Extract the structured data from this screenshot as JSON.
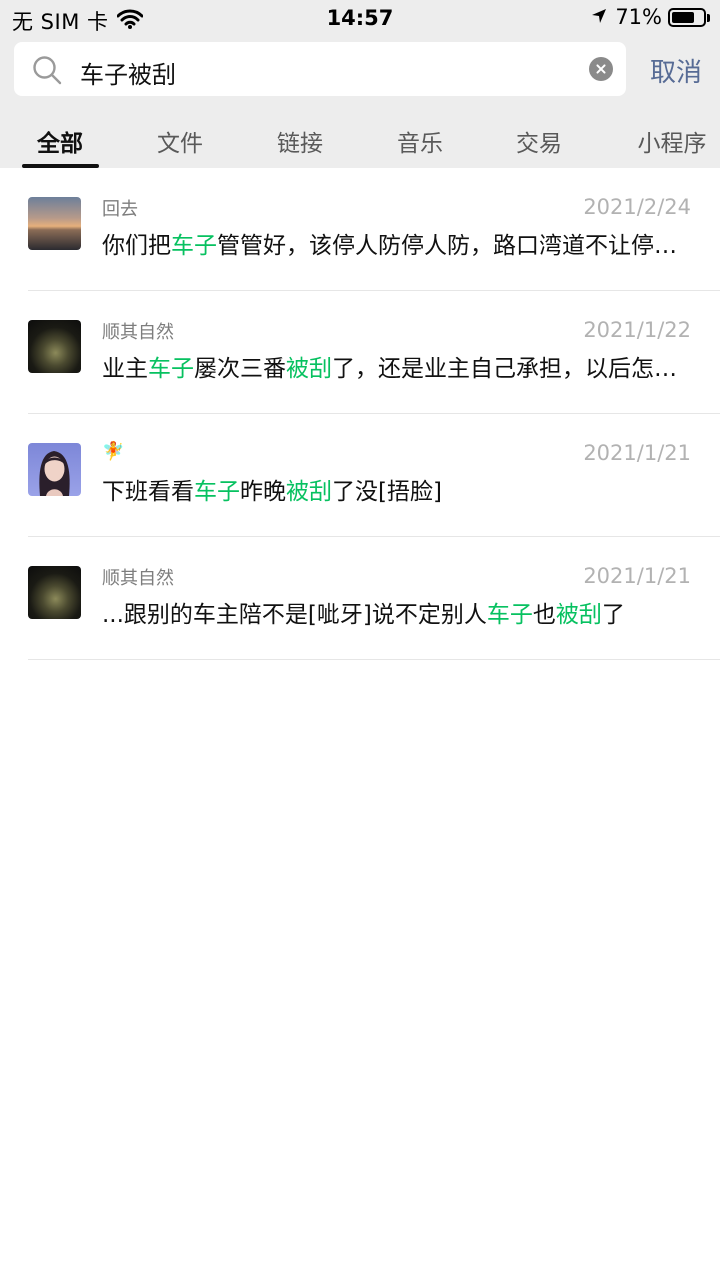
{
  "status_bar": {
    "carrier": "无 SIM 卡",
    "time": "14:57",
    "battery": "71%"
  },
  "search": {
    "query": "车子被刮",
    "cancel_label": "取消"
  },
  "tabs": [
    "全部",
    "文件",
    "链接",
    "音乐",
    "交易",
    "小程序"
  ],
  "active_tab": "全部",
  "highlight_color": "#07c160",
  "results": [
    {
      "sender": "回去",
      "date": "2021/2/24",
      "avatar": "sunset-avatar",
      "snippet": [
        {
          "t": "你们把"
        },
        {
          "t": "车子",
          "hl": true
        },
        {
          "t": "管管好，该停人防停人防，路口湾道不让停那么多车"
        }
      ]
    },
    {
      "sender": "顺其自然",
      "date": "2021/1/22",
      "avatar": "buddha-avatar",
      "snippet": [
        {
          "t": "业主"
        },
        {
          "t": "车子",
          "hl": true
        },
        {
          "t": "屡次三番"
        },
        {
          "t": "被刮",
          "hl": true
        },
        {
          "t": "了，还是业主自己承担，以后怎么办"
        }
      ]
    },
    {
      "sender": "🧚",
      "date": "2021/1/21",
      "avatar": "girl-avatar",
      "snippet": [
        {
          "t": "下班看看"
        },
        {
          "t": "车子",
          "hl": true
        },
        {
          "t": "昨晚"
        },
        {
          "t": "被刮",
          "hl": true
        },
        {
          "t": "了没[捂脸]"
        }
      ]
    },
    {
      "sender": "顺其自然",
      "date": "2021/1/21",
      "avatar": "buddha-avatar",
      "snippet": [
        {
          "t": "...跟别的车主陪不是[呲牙]说不定别人"
        },
        {
          "t": "车子",
          "hl": true
        },
        {
          "t": "也"
        },
        {
          "t": "被刮",
          "hl": true
        },
        {
          "t": "了"
        }
      ]
    }
  ]
}
